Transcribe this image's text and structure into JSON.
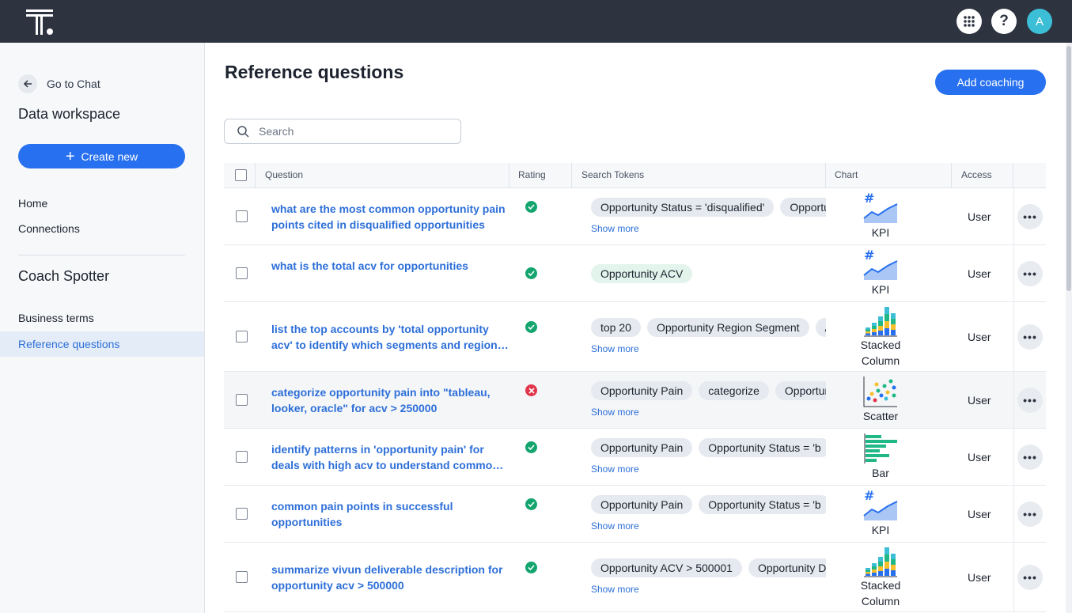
{
  "header": {
    "avatar_initial": "A",
    "help_label": "?"
  },
  "sidebar": {
    "back_label": "Go to Chat",
    "workspace_title": "Data workspace",
    "create_label": "Create new",
    "nav": [
      "Home",
      "Connections"
    ],
    "coach_title": "Coach Spotter",
    "coach_items": [
      "Business terms",
      "Reference questions"
    ]
  },
  "main": {
    "title": "Reference questions",
    "add_label": "Add coaching",
    "search_placeholder": "Search"
  },
  "table": {
    "columns": {
      "question": "Question",
      "rating": "Rating",
      "tokens": "Search Tokens",
      "chart": "Chart",
      "access": "Access"
    },
    "show_more": "Show more",
    "rows": [
      {
        "question": "what are the most common opportunity pain points cited in disqualified opportunities",
        "rating": "positive",
        "tokens": [
          "Opportunity Status = 'disqualified'",
          "Opportunity Pain"
        ],
        "chart_type": "KPI",
        "access": "User"
      },
      {
        "question": "what is the total acv for opportunities",
        "rating": "positive",
        "tokens": [
          "Opportunity ACV"
        ],
        "chart_type": "KPI",
        "access": "User"
      },
      {
        "question": "list the top accounts by 'total opportunity acv' to identify which segments and regions contribute most",
        "rating": "positive",
        "tokens": [
          "top 20",
          "Opportunity Region Segment",
          "Account"
        ],
        "chart_type": "Stacked Column",
        "access": "User"
      },
      {
        "question": "categorize opportunity pain into \"tableau, looker, oracle\" for acv > 250000",
        "rating": "negative",
        "tokens": [
          "Opportunity Pain",
          "categorize",
          "Opportunity ACV"
        ],
        "chart_type": "Scatter",
        "access": "User"
      },
      {
        "question": "identify patterns in 'opportunity pain' for deals with high acv to understand common themes",
        "rating": "positive",
        "tokens": [
          "Opportunity Pain",
          "Opportunity Status = 'b"
        ],
        "chart_type": "Bar",
        "access": "User"
      },
      {
        "question": "common pain points in successful opportunities",
        "rating": "positive",
        "tokens": [
          "Opportunity Pain",
          "Opportunity Status = 'b"
        ],
        "chart_type": "KPI",
        "access": "User"
      },
      {
        "question": "summarize vivun deliverable description for opportunity acv > 500000",
        "rating": "positive",
        "tokens": [
          "Opportunity ACV > 500001",
          "Opportunity Deliverable"
        ],
        "chart_type": "Stacked Column",
        "access": "User"
      }
    ]
  },
  "colors": {
    "accent": "#2770ef",
    "positive": "#14a56f",
    "negative": "#e0364b",
    "header_bg": "#2e3340"
  }
}
